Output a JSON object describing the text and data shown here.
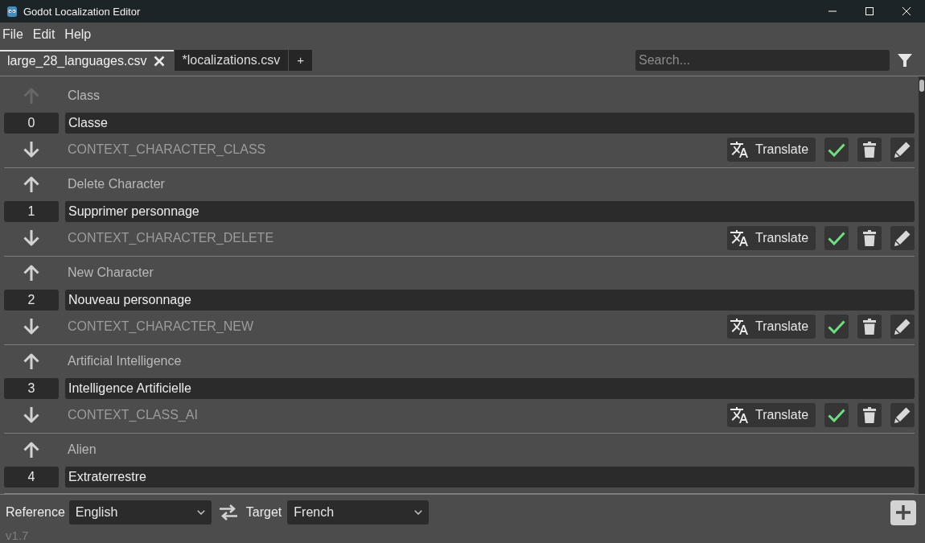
{
  "window": {
    "title": "Godot Localization Editor"
  },
  "menu": [
    "File",
    "Edit",
    "Help"
  ],
  "tabs": [
    {
      "label": "large_28_languages.csv",
      "selected": true
    },
    {
      "label": "*localizations.csv",
      "selected": false
    }
  ],
  "add_tab": "+",
  "search": {
    "placeholder": "Search..."
  },
  "entries": [
    {
      "source": "Class",
      "index": "0",
      "translation": "Classe",
      "context": "CONTEXT_CHARACTER_CLASS",
      "up_enabled": false,
      "down_enabled": true,
      "completed": true,
      "button": "Translate"
    },
    {
      "source": "Delete Character",
      "index": "1",
      "translation": "Supprimer personnage",
      "context": "CONTEXT_CHARACTER_DELETE",
      "up_enabled": true,
      "down_enabled": true,
      "completed": true,
      "button": "Translate"
    },
    {
      "source": "New Character",
      "index": "2",
      "translation": "Nouveau personnage",
      "context": "CONTEXT_CHARACTER_NEW",
      "up_enabled": true,
      "down_enabled": true,
      "completed": true,
      "button": "Translate"
    },
    {
      "source": "Artificial Intelligence",
      "index": "3",
      "translation": "Intelligence Artificielle",
      "context": "CONTEXT_CLASS_AI",
      "up_enabled": true,
      "down_enabled": true,
      "completed": true,
      "button": "Translate"
    },
    {
      "source": "Alien",
      "index": "4",
      "translation": "Extraterrestre",
      "up_enabled": true
    }
  ],
  "footer": {
    "reference_label": "Reference",
    "reference": "English",
    "target_label": "Target",
    "target": "French",
    "version": "v1.7"
  }
}
